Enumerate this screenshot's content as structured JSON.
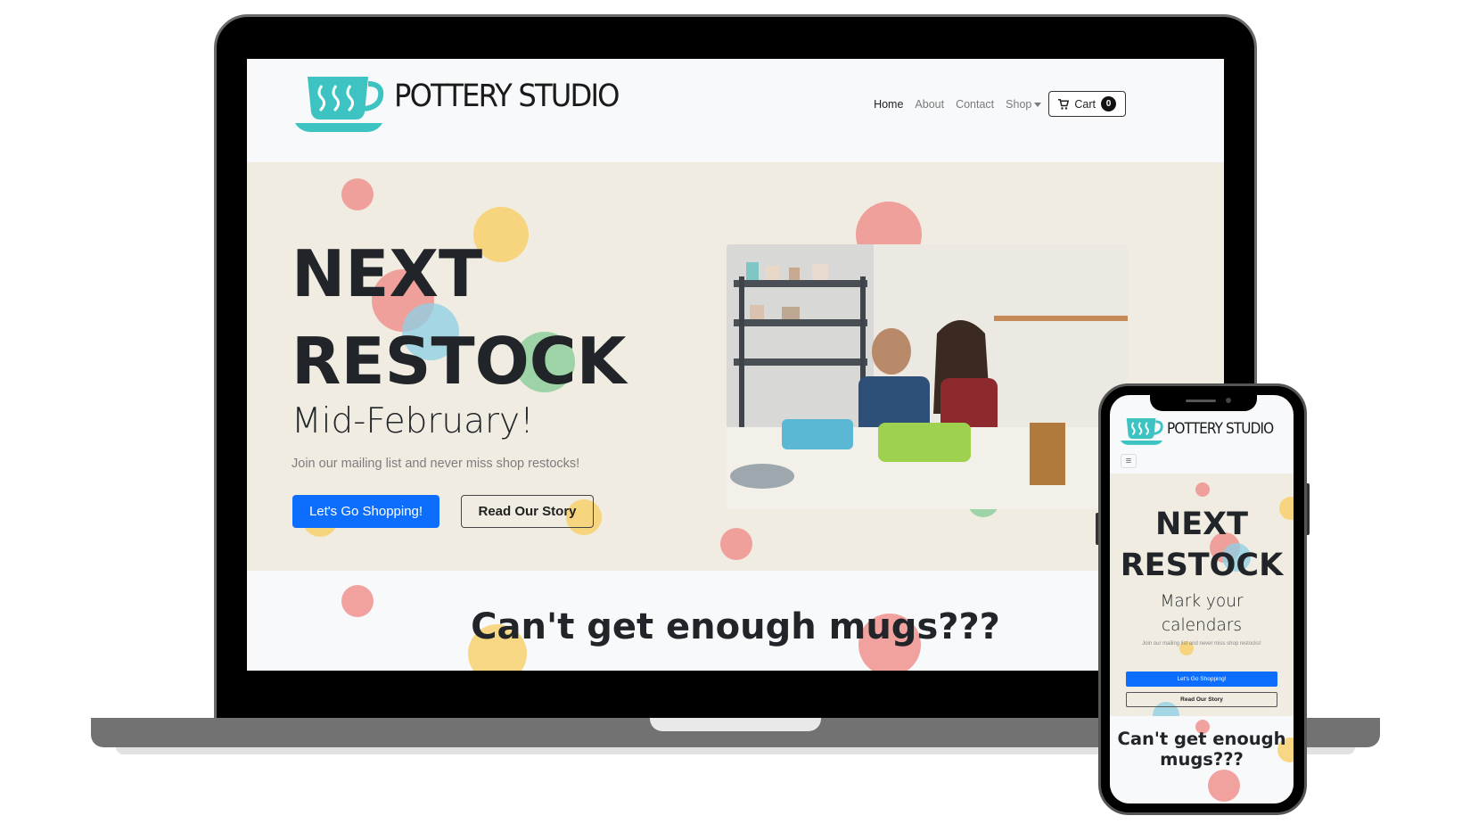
{
  "brand": {
    "name": "POTTERY STUDIO",
    "accent": "#3ec3c3"
  },
  "nav": {
    "links": [
      "Home",
      "About",
      "Contact",
      "Shop"
    ],
    "cart_label": "Cart",
    "cart_count": "0"
  },
  "hero": {
    "title_line1": "NEXT",
    "title_line2": "RESTOCK",
    "subtitle": "Mid-February!",
    "description": "Join our mailing list and never miss shop restocks!",
    "primary_button": "Let's Go Shopping!",
    "secondary_button": "Read Our Story"
  },
  "section2": {
    "title": "Can't get enough mugs???"
  },
  "mobile": {
    "brand_name": "POTTERY STUDIO",
    "title_line1": "NEXT",
    "title_line2": "RESTOCK",
    "subtitle_line1": "Mark your",
    "subtitle_line2": "calendars",
    "description": "Join our mailing list and never miss shop restocks!",
    "primary_button": "Let's Go Shopping!",
    "secondary_button": "Read Our Story",
    "section2_title_line1": "Can't get enough",
    "section2_title_line2": "mugs???"
  },
  "colors": {
    "hero_bg": "#f0ece1",
    "primary": "#0d6efd",
    "dot_red": "#ef8f8a",
    "dot_yellow": "#f7cf68",
    "dot_blue": "#8fd0e4",
    "dot_green": "#8fcf9c"
  }
}
